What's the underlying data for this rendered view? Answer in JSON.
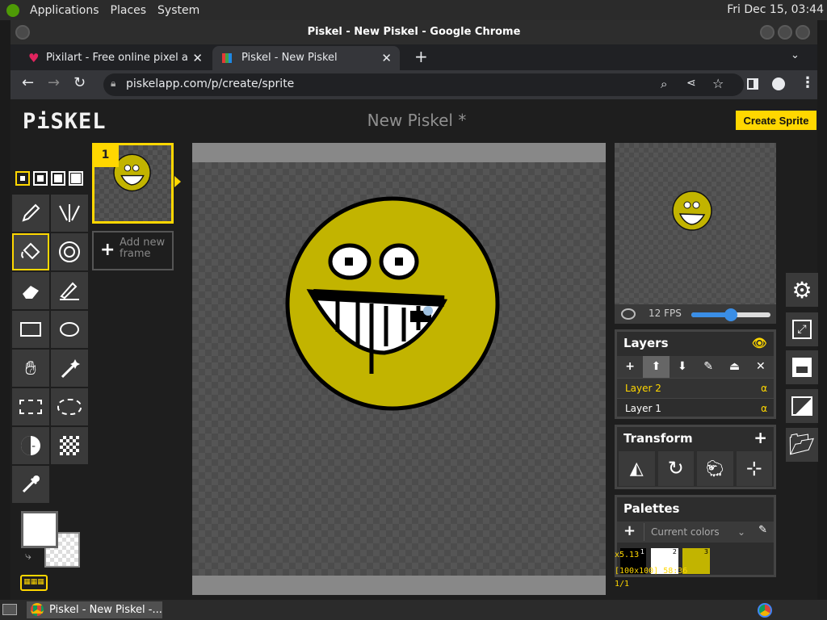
{
  "topbar": {
    "menus": [
      "Applications",
      "Places",
      "System"
    ],
    "clock": "Fri Dec 15, 03:44"
  },
  "window": {
    "title": "Piskel - New Piskel - Google Chrome"
  },
  "tabs": [
    {
      "label": "Pixilart - Free online pixel art"
    },
    {
      "label": "Piskel - New Piskel"
    }
  ],
  "address": {
    "url": "piskelapp.com/p/create/sprite"
  },
  "piskel": {
    "logo": "PiSKEL",
    "doc_title": "New Piskel *",
    "create_button": "Create Sprite",
    "frame_number": "1",
    "add_frame": "Add new frame",
    "fps_label": "12 FPS",
    "fps_value": 12,
    "fps_max": 24,
    "layers_title": "Layers",
    "layers": [
      {
        "name": "Layer 2",
        "selected": true,
        "alpha": "α"
      },
      {
        "name": "Layer 1",
        "selected": false,
        "alpha": "α"
      }
    ],
    "transform_title": "Transform",
    "palettes_title": "Palettes",
    "palette_select": "Current colors",
    "palette_swatches": [
      {
        "index": "1",
        "color": "#000000"
      },
      {
        "index": "2",
        "color": "#ffffff"
      },
      {
        "index": "3",
        "color": "#c2b400"
      }
    ],
    "zoom_info": "x5.13",
    "size_info": "[100x100] 58:36",
    "frame_info": "1/1"
  },
  "colors": {
    "accent": "#ffd700",
    "sprite": "#c2b400",
    "primary": "#ffffff"
  },
  "taskbar": {
    "item": "Piskel - New Piskel -..."
  }
}
